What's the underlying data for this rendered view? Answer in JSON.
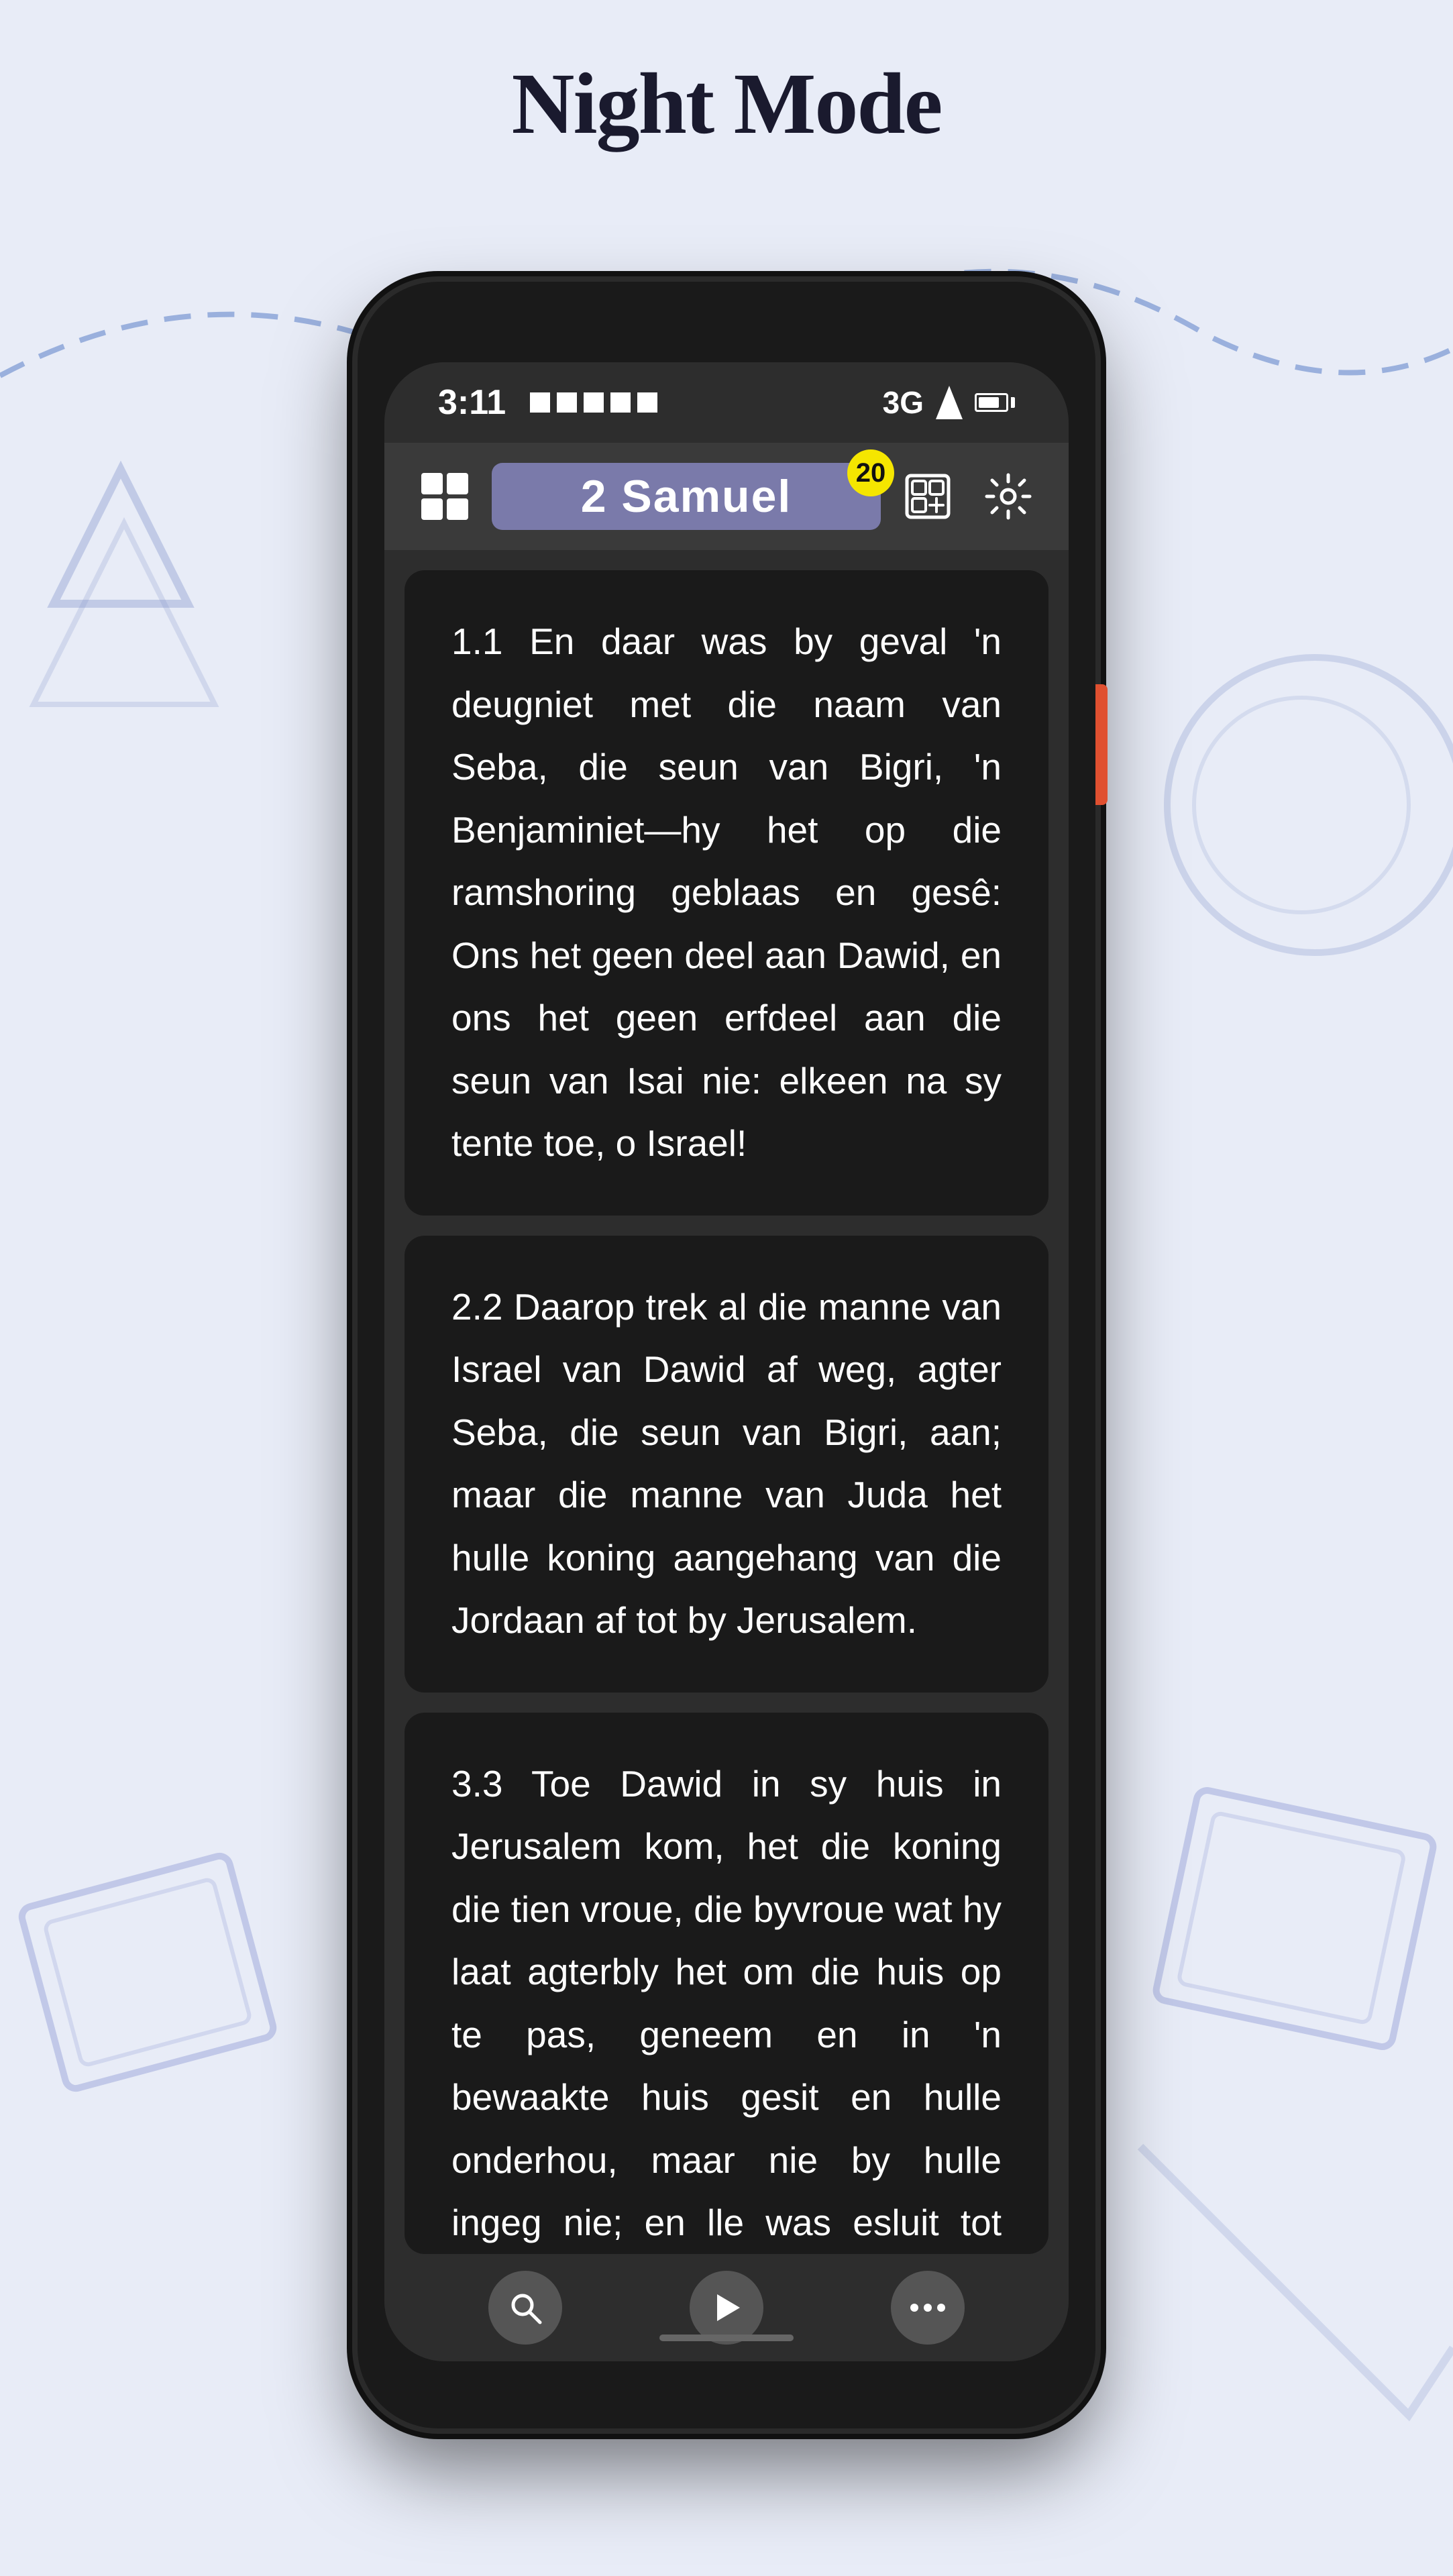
{
  "page": {
    "title": "Night Mode",
    "background_color": "#e8ecf7"
  },
  "status_bar": {
    "time": "3:11",
    "network": "3G",
    "signal_level": 3,
    "battery_percent": 80
  },
  "toolbar": {
    "book_title": "2  Samuel",
    "badge_count": "20",
    "logo_alt": "app-logo",
    "gallery_icon": "🖼",
    "settings_icon": "⚙"
  },
  "verses": [
    {
      "id": "verse-1",
      "text": "1.1  En daar was by geval 'n deugniet met die naam van Seba, die seun van Bigri, 'n Benjaminiet—hy het op die ramshoring geblaas en gesê: Ons het geen deel aan Dawid, en ons het geen erfdeel aan die seun van Isai nie: elkeen na sy tente toe, o Israel!"
    },
    {
      "id": "verse-2",
      "text": "2.2  Daarop trek al die manne van Israel van Dawid af weg, agter Seba, die seun van Bigri, aan; maar die manne van Juda het hulle koning aangehang van die Jordaan af tot by Jerusalem."
    },
    {
      "id": "verse-3",
      "text": "3.3  Toe Dawid in sy huis in Jerusalem kom, het die koning die tien vroue, die byvroue wat hy laat agterbly het om die huis op te pas, geneem en in 'n bewaakte huis gesit en hulle onderhou, maar nie by hulle ingeg  nie; en  lle was   esluit tot   dag    hulle    as"
    }
  ],
  "bottom_nav": {
    "search_label": "search",
    "play_label": "play",
    "more_label": "more"
  }
}
